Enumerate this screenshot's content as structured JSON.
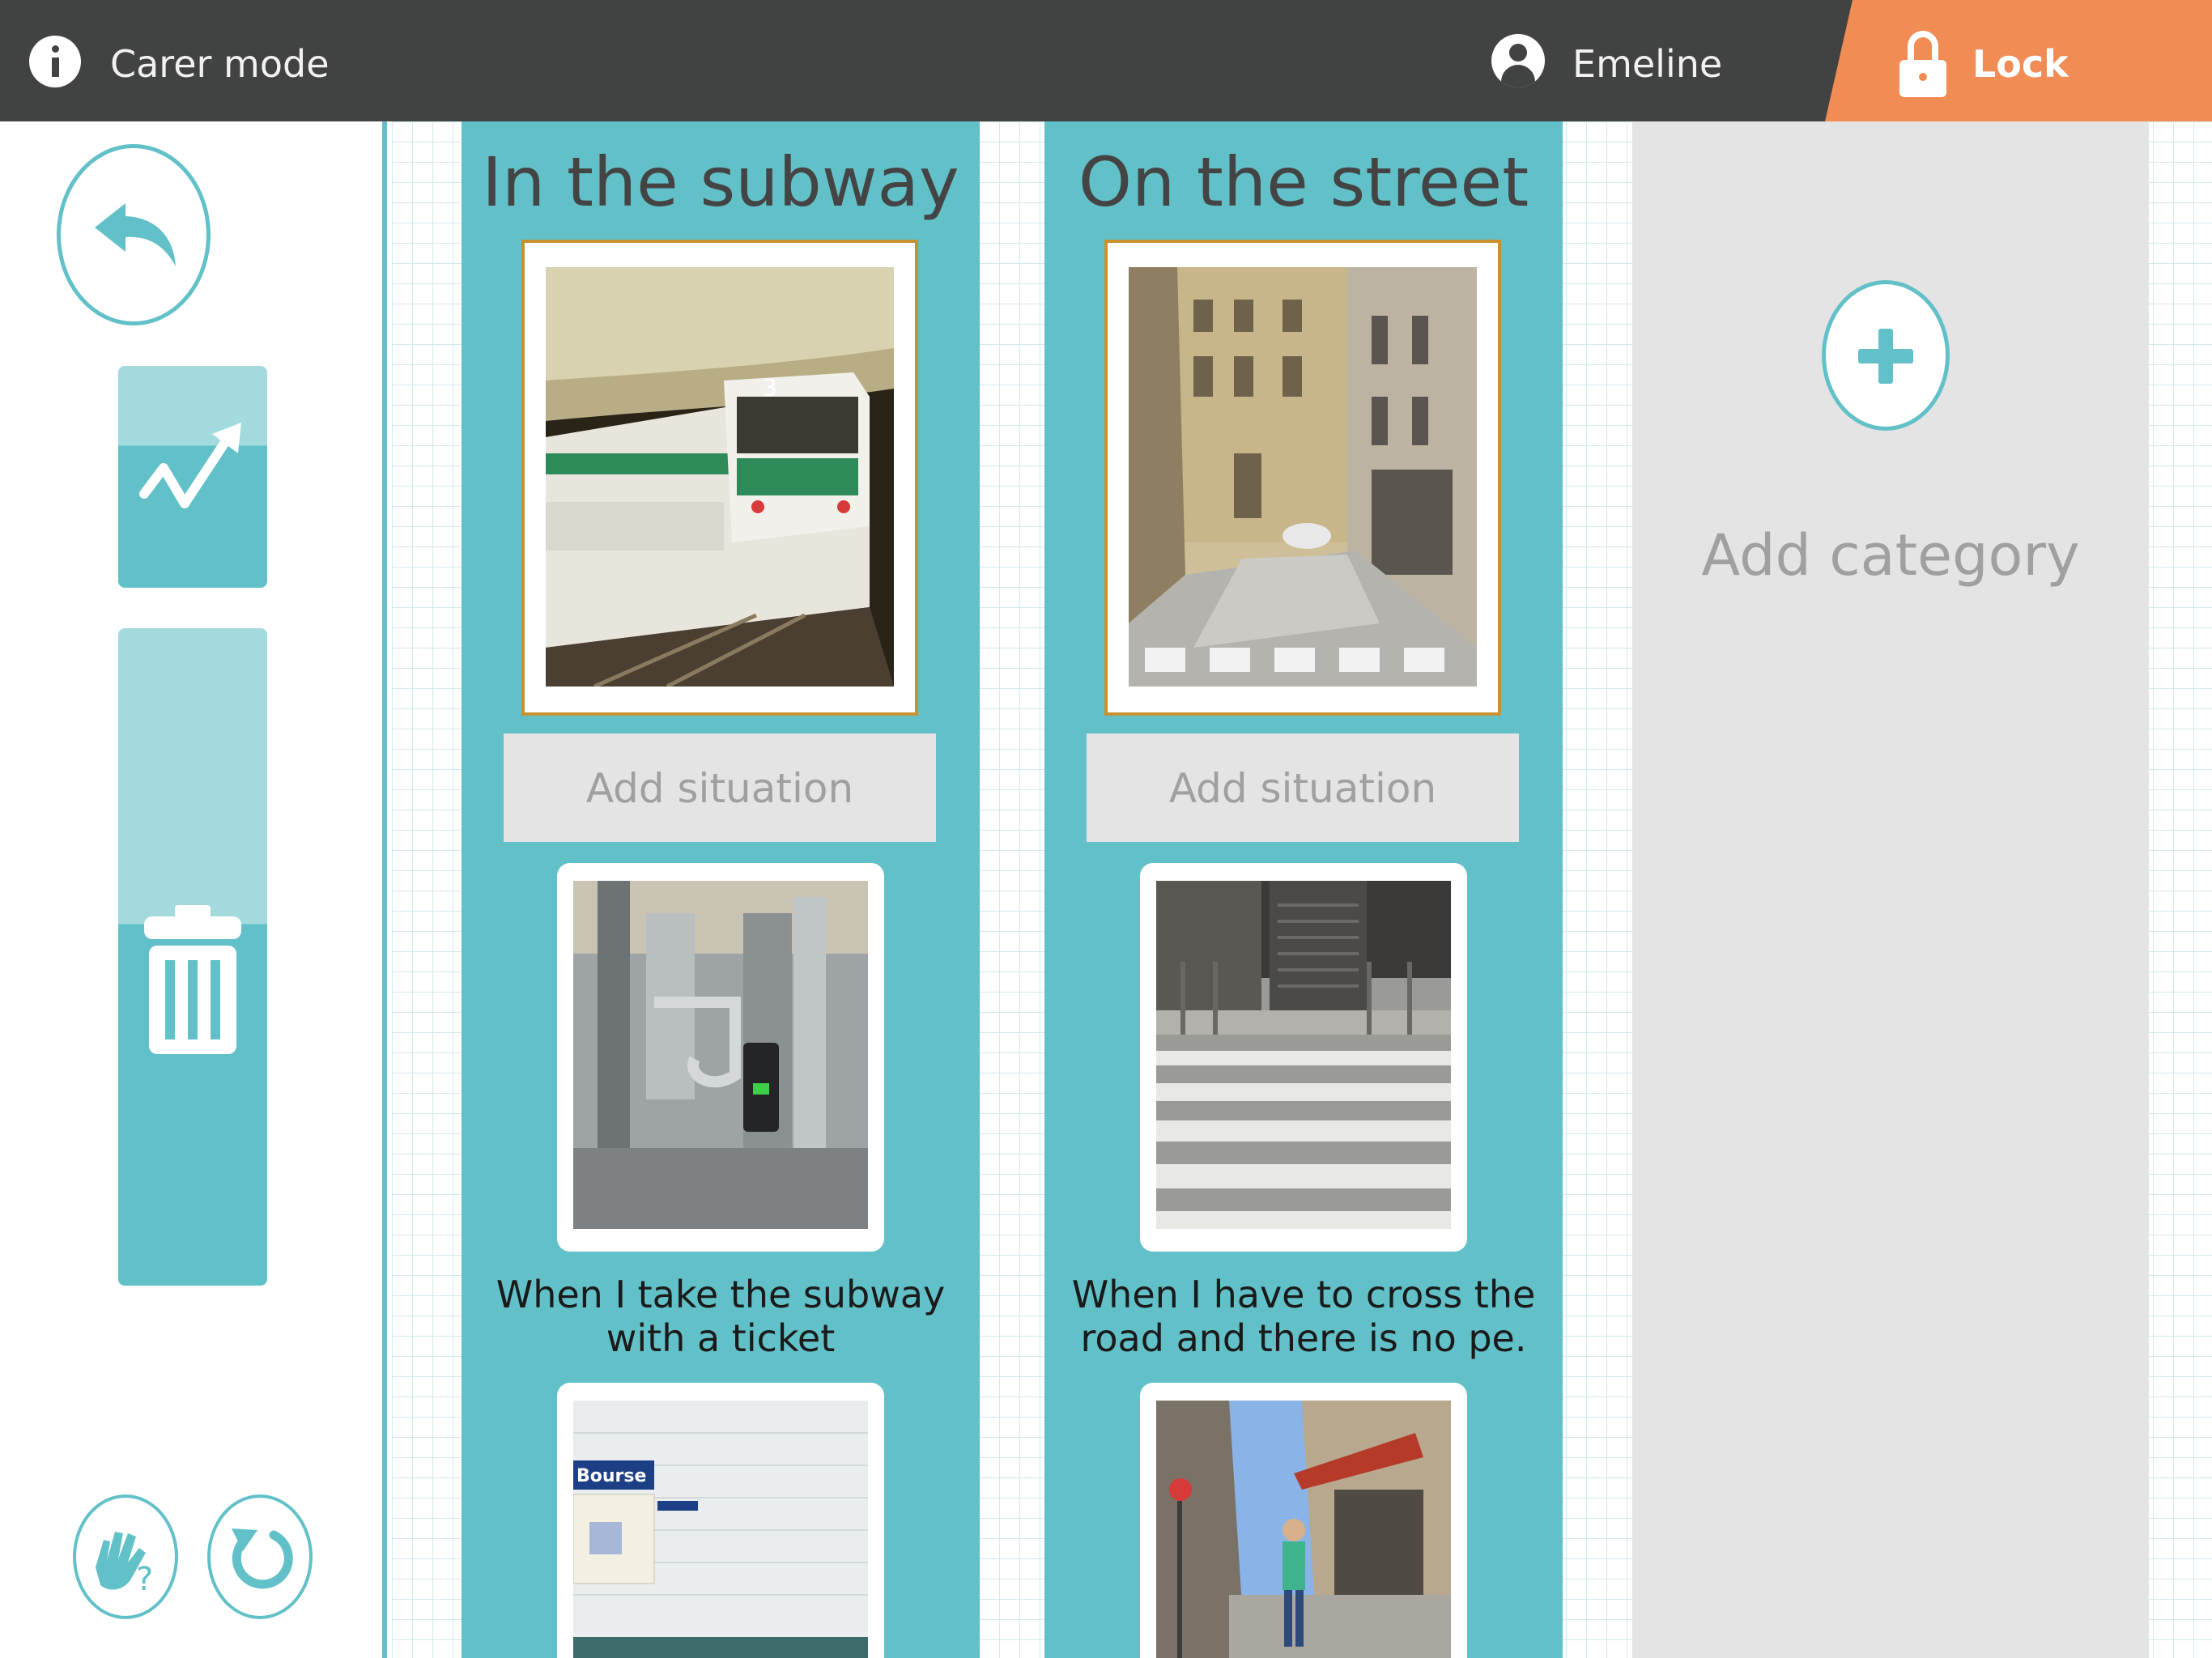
{
  "topbar": {
    "mode_label": "Carer mode",
    "user_name": "Emeline",
    "lock_label": "Lock",
    "colors": {
      "bar": "#414242",
      "lock": "#f08c54"
    }
  },
  "sidebar": {
    "icons": [
      "back-arrow-icon",
      "progress-chart-icon",
      "trash-icon",
      "help-hand-icon",
      "refresh-icon"
    ]
  },
  "categories": [
    {
      "title": "In the subway",
      "photo_icon": "subway-train-photo",
      "add_situation_label": "Add situation",
      "situations": [
        {
          "label_line1": "When I take the subway",
          "label_line2": "with a ticket",
          "photo_icon": "ticket-gate-photo"
        },
        {
          "photo_icon": "bourse-station-photo",
          "photo_sign": "Bourse"
        }
      ]
    },
    {
      "title": "On the street",
      "photo_icon": "street-photo",
      "add_situation_label": "Add situation",
      "situations": [
        {
          "label_line1": "When I have to cross the",
          "label_line2": "road and there is no pe.",
          "photo_icon": "crosswalk-photo"
        },
        {
          "photo_icon": "pedestrian-street-photo"
        }
      ]
    }
  ],
  "add_category": {
    "label": "Add category"
  },
  "accent_color": "#62c1c8"
}
